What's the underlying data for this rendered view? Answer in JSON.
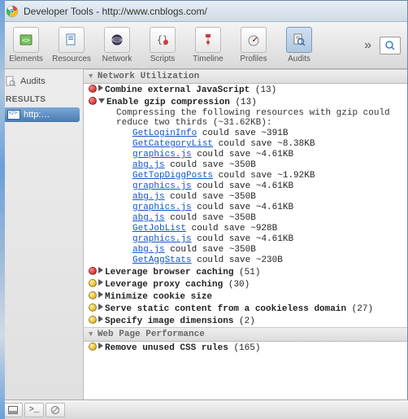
{
  "window": {
    "title": "Developer Tools - http://www.cnblogs.com/"
  },
  "toolbar": {
    "elements": {
      "label": "Elements"
    },
    "resources": {
      "label": "Resources"
    },
    "network": {
      "label": "Network"
    },
    "scripts": {
      "label": "Scripts"
    },
    "timeline": {
      "label": "Timeline"
    },
    "profiles": {
      "label": "Profiles"
    },
    "audits": {
      "label": "Audits"
    },
    "more": "»"
  },
  "sidebar": {
    "audits_label": "Audits",
    "results_header": "RESULTS",
    "item_label": "http:…"
  },
  "sections": {
    "network_util": "Network Utilization",
    "web_perf": "Web Page Performance"
  },
  "rules": {
    "combine_js": {
      "title": "Combine external JavaScript",
      "count": "(13)",
      "severity": "red"
    },
    "gzip": {
      "title": "Enable gzip compression",
      "count": "(13)",
      "severity": "red",
      "desc": "Compressing the following resources with gzip could reduce two thirds (~31.62KB):"
    },
    "browser_cache": {
      "title": "Leverage browser caching",
      "count": "(51)",
      "severity": "red"
    },
    "proxy_cache": {
      "title": "Leverage proxy caching",
      "count": "(30)",
      "severity": "yellow"
    },
    "cookie_size": {
      "title": "Minimize cookie size",
      "count": "",
      "severity": "yellow"
    },
    "cookieless": {
      "title": "Serve static content from a cookieless domain",
      "count": "(27)",
      "severity": "yellow"
    },
    "img_dims": {
      "title": "Specify image dimensions",
      "count": "(2)",
      "severity": "yellow"
    },
    "unused_css": {
      "title": "Remove unused CSS rules",
      "count": "(165)",
      "severity": "yellow"
    }
  },
  "gzip_resources": [
    {
      "name": "GetLoginInfo",
      "save": " could save ~391B"
    },
    {
      "name": "GetCategoryList",
      "save": " could save ~8.38KB"
    },
    {
      "name": "graphics.js",
      "save": " could save ~4.61KB"
    },
    {
      "name": "abg.js",
      "save": " could save ~350B"
    },
    {
      "name": "GetTopDiggPosts",
      "save": " could save ~1.92KB"
    },
    {
      "name": "graphics.js",
      "save": " could save ~4.61KB"
    },
    {
      "name": "abg.js",
      "save": " could save ~350B"
    },
    {
      "name": "graphics.js",
      "save": " could save ~4.61KB"
    },
    {
      "name": "abg.js",
      "save": " could save ~350B"
    },
    {
      "name": "GetJobList",
      "save": " could save ~928B"
    },
    {
      "name": "graphics.js",
      "save": " could save ~4.61KB"
    },
    {
      "name": "abg.js",
      "save": " could save ~350B"
    },
    {
      "name": "GetAggStats",
      "save": " could save ~230B"
    }
  ]
}
